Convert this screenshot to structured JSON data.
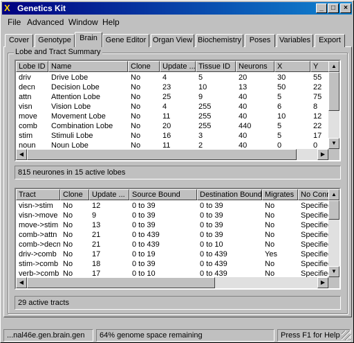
{
  "window": {
    "title": "Genetics Kit",
    "minimize_icon": "minimize-icon",
    "maximize_icon": "maximize-icon",
    "close_icon": "close-icon"
  },
  "menu": {
    "file": "File",
    "advanced": "Advanced",
    "window": "Window",
    "help": "Help"
  },
  "tabs": [
    "Cover",
    "Genotype",
    "Brain",
    "Gene Editor",
    "Organ View",
    "Biochemistry",
    "Poses",
    "Variables",
    "Export"
  ],
  "active_tab": "Brain",
  "group": {
    "label": "Lobe and Tract Summary"
  },
  "lobes": {
    "columns": [
      "Lobe ID",
      "Name",
      "Clone",
      "Update ...",
      "Tissue ID",
      "Neurons",
      "X",
      "Y"
    ],
    "rows": [
      [
        "driv",
        "Drive Lobe",
        "No",
        "4",
        "5",
        "20",
        "30",
        "55"
      ],
      [
        "decn",
        "Decision Lobe",
        "No",
        "23",
        "10",
        "13",
        "50",
        "22"
      ],
      [
        "attn",
        "Attention Lobe",
        "No",
        "25",
        "9",
        "40",
        "5",
        "75"
      ],
      [
        "visn",
        "Vision Lobe",
        "No",
        "4",
        "255",
        "40",
        "6",
        "8"
      ],
      [
        "move",
        "Movement Lobe",
        "No",
        "11",
        "255",
        "40",
        "10",
        "12"
      ],
      [
        "comb",
        "Combination Lobe",
        "No",
        "20",
        "255",
        "440",
        "5",
        "22"
      ],
      [
        "stim",
        "Stimuli Lobe",
        "No",
        "16",
        "3",
        "40",
        "5",
        "17"
      ],
      [
        "noun",
        "Noun Lobe",
        "No",
        "11",
        "2",
        "40",
        "0",
        "0"
      ]
    ]
  },
  "lobe_summary": "815 neurones in  15 active lobes",
  "tracts": {
    "columns": [
      "Tract",
      "Clone",
      "Update ...",
      "Source Bound",
      "Destination Bound",
      "Migrates",
      "No Conn"
    ],
    "rows": [
      [
        "visn->stim",
        "No",
        "12",
        "0 to  39",
        "0 to  39",
        "No",
        "Specified"
      ],
      [
        "visn->move",
        "No",
        "9",
        "0 to  39",
        "0 to  39",
        "No",
        "Specified"
      ],
      [
        "move->stim",
        "No",
        "13",
        "0 to  39",
        "0 to  39",
        "No",
        "Specified"
      ],
      [
        "comb->attn",
        "No",
        "21",
        "0 to  439",
        "0 to  39",
        "No",
        "Specified"
      ],
      [
        "comb->decn",
        "No",
        "21",
        "0 to  439",
        "0 to  10",
        "No",
        "Specified"
      ],
      [
        "driv->comb",
        "No",
        "17",
        "0 to  19",
        "0 to  439",
        "Yes",
        "Specified"
      ],
      [
        "stim->comb",
        "No",
        "18",
        "0 to  39",
        "0 to  439",
        "No",
        "Specified"
      ],
      [
        "verb->comb",
        "No",
        "17",
        "0 to  10",
        "0 to  439",
        "No",
        "Specified"
      ]
    ]
  },
  "tract_summary": "29 active tracts",
  "status": {
    "file": "...nal46e.gen.brain.gen",
    "space": "64% genome space remaining",
    "help": "Press F1 for Help"
  }
}
